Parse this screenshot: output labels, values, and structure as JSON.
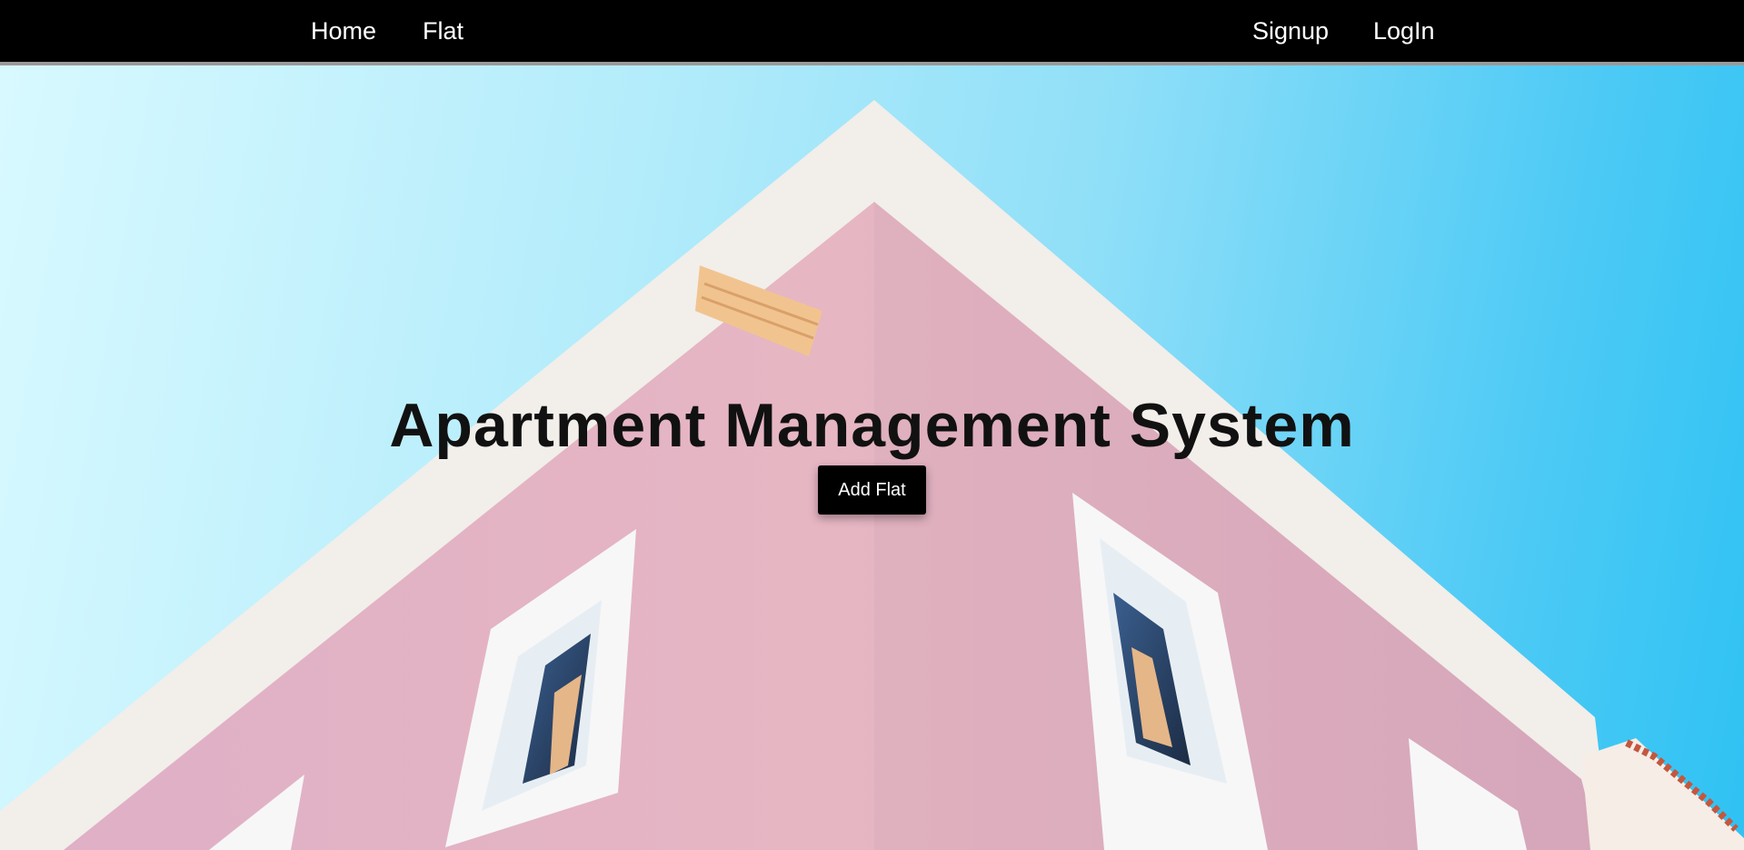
{
  "nav": {
    "left_links": [
      "Home",
      "Flat"
    ],
    "right_links": [
      "Signup",
      "LogIn"
    ]
  },
  "hero": {
    "title": "Apartment Management System",
    "button_label": "Add Flat",
    "background_image": "pink-building-against-blue-sky"
  },
  "colors": {
    "navbar_bg": "#000000",
    "nav_text": "#ffffff",
    "building_pink": "#e4b3c4",
    "trim_white": "#f4f1ee",
    "sky_light": "#d8f9ff",
    "sky_deep": "#2fc2f3",
    "title_text": "#111111",
    "button_bg": "#000000"
  }
}
